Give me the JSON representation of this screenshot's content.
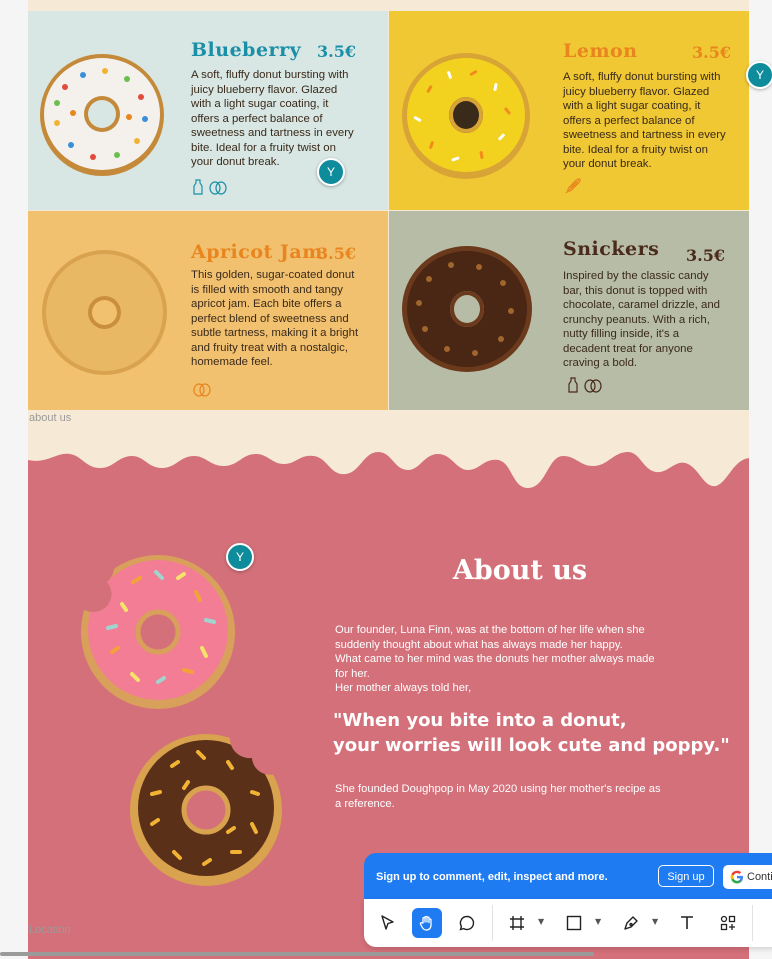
{
  "products": [
    {
      "name": "Blueberry",
      "price": "3.5€",
      "description": [
        "A soft, fluffy donut bursting with",
        "juicy blueberry flavor. Glazed",
        "with a light sugar coating, it",
        "offers a perfect balance of",
        "sweetness and tartness in every",
        "bite. Ideal for a fruity twist on",
        "your donut break."
      ],
      "icons": [
        "milk-bottle-icon",
        "egg-icon"
      ],
      "color": "#1a8fa8"
    },
    {
      "name": "Lemon",
      "price": "3.5€",
      "description": [
        "A soft, fluffy donut bursting with",
        "juicy blueberry flavor. Glazed",
        "with a light sugar coating, it",
        "offers a perfect balance of",
        "sweetness and tartness in every",
        "bite. Ideal for a fruity twist on",
        "your donut break."
      ],
      "icons": [
        "wheat-icon"
      ],
      "color": "#e8851e"
    },
    {
      "name": "Apricot Jam",
      "price": "3.5€",
      "description": [
        "This golden, sugar-coated donut",
        "is filled with smooth and tangy",
        "apricot jam. Each bite offers a",
        "perfect blend of sweetness and",
        "subtle tartness, making it a bright",
        "and fruity treat with a nostalgic,",
        "homemade feel."
      ],
      "icons": [
        "egg-icon"
      ],
      "color": "#e8851e"
    },
    {
      "name": "Snickers",
      "price": "3.5€",
      "description": [
        "Inspired by the classic candy",
        "bar, this donut is topped with",
        "chocolate, caramel drizzle, and",
        "crunchy peanuts. With a rich,",
        "nutty filling inside, it's a",
        "decadent treat for anyone",
        "craving a bold."
      ],
      "icons": [
        "milk-bottle-icon",
        "egg-icon"
      ],
      "color": "#4a2a1a"
    }
  ],
  "frame_labels": {
    "about": "about us",
    "location": "Location"
  },
  "about": {
    "title": "About us",
    "paragraph1": [
      "Our founder, Luna Finn, was at the bottom of her life when she",
      "suddenly thought about what has always made her happy.",
      "What came to her mind was the donuts her mother always made",
      "for her.",
      "Her mother always told her,"
    ],
    "quote": [
      "\"When you bite into a donut,",
      "your worries will look cute and poppy.\""
    ],
    "paragraph2": [
      "She founded Doughpop in May 2020 using her mother's recipe as",
      "a reference."
    ]
  },
  "avatars": {
    "initial": "Y"
  },
  "toolbar": {
    "banner_text": "Sign up to comment, edit, inspect and more.",
    "signup_label": "Sign up",
    "google_label": "Continue with Google",
    "tools": [
      "move-tool",
      "hand-tool",
      "comment-tool",
      "frame-tool",
      "shape-tool",
      "pen-tool",
      "text-tool",
      "components-tool"
    ]
  },
  "colors": {
    "pink": "#d4707a",
    "cream": "#f6ead7",
    "accent": "#1f7bf2",
    "avatar": "#0f8c9c"
  }
}
